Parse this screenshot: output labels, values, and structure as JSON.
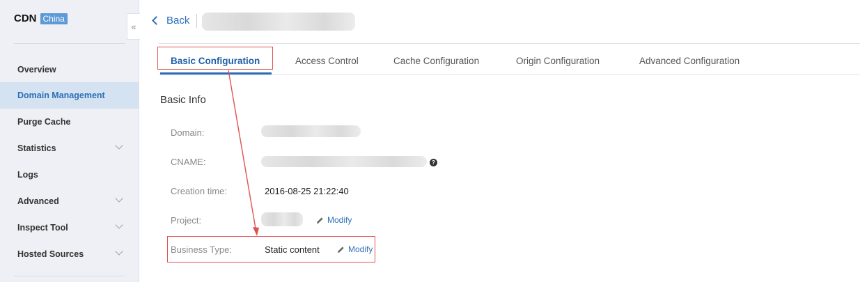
{
  "sidebar": {
    "brand_title": "CDN",
    "brand_badge": "China",
    "items": [
      {
        "label": "Overview"
      },
      {
        "label": "Domain Management"
      },
      {
        "label": "Purge Cache"
      },
      {
        "label": "Statistics"
      },
      {
        "label": "Logs"
      },
      {
        "label": "Advanced"
      },
      {
        "label": "Inspect Tool"
      },
      {
        "label": "Hosted Sources"
      }
    ],
    "active_item": "Domain Management"
  },
  "header": {
    "back_label": "Back"
  },
  "tabs": [
    {
      "label": "Basic Configuration"
    },
    {
      "label": "Access Control"
    },
    {
      "label": "Cache Configuration"
    },
    {
      "label": "Origin Configuration"
    },
    {
      "label": "Advanced Configuration"
    }
  ],
  "active_tab": "Basic Configuration",
  "basic_info": {
    "title": "Basic Info",
    "domain_label": "Domain:",
    "cname_label": "CNAME:",
    "creation_time_label": "Creation time:",
    "creation_time_value": "2016-08-25 21:22:40",
    "project_label": "Project:",
    "project_modify": "Modify",
    "business_type_label": "Business Type:",
    "business_type_value": "Static content",
    "business_type_modify": "Modify",
    "cname_help_icon": "?"
  },
  "colors": {
    "accent": "#2a6fb8",
    "annotation": "#e05252"
  }
}
